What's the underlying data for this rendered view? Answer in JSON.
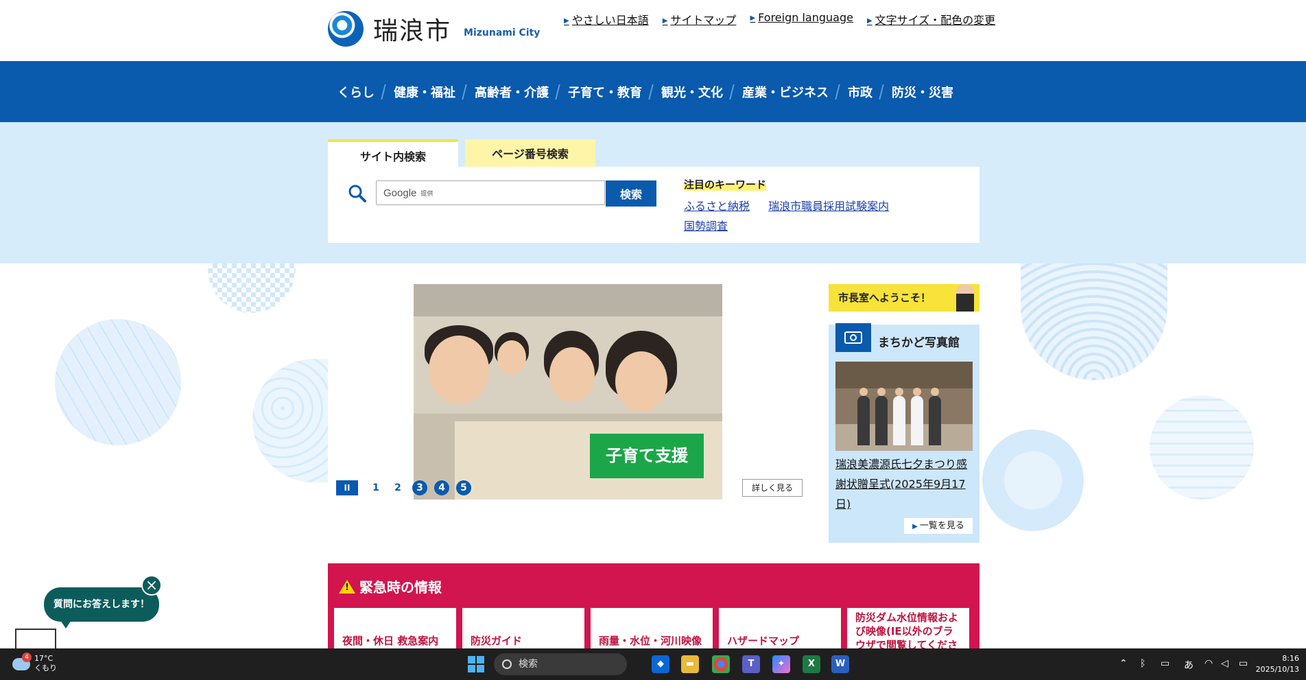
{
  "header": {
    "logo_text": "瑞浪市",
    "logo_sub": "Mizunami City",
    "util_links": [
      "やさしい日本語",
      "サイトマップ",
      "Foreign language",
      "文字サイズ・配色の変更"
    ]
  },
  "nav": [
    "くらし",
    "健康・福祉",
    "高齢者・介護",
    "子育て・教育",
    "観光・文化",
    "産業・ビジネス",
    "市政",
    "防災・災害"
  ],
  "search": {
    "tab_site": "サイト内検索",
    "tab_page": "ページ番号検索",
    "input_brand": "Google",
    "input_brand_sub": "提供",
    "button": "検索",
    "keywords_title": "注目のキーワード",
    "keywords": [
      "ふるさと納税",
      "瑞浪市職員採用試験案内",
      "国勢調査"
    ]
  },
  "slider": {
    "badge": "子育て支援",
    "pause": "II",
    "dots": [
      "1",
      "2",
      "3",
      "4",
      "5"
    ],
    "more": "詳しく見る"
  },
  "sidebar": {
    "mayor": "市長室へようこそ！",
    "photo_title": "まちかど写真館",
    "photo_caption": "瑞浪美濃源氏七夕まつり感謝状贈呈式(2025年9月17日)",
    "list_button": "一覧を見る"
  },
  "emergency": {
    "title": "緊急時の情報",
    "cards": [
      "夜間・休日 救急案内",
      "防災ガイド",
      "雨量・水位・河川映像",
      "ハザードマップ",
      "防災ダム水位情報および映像(IE以外のブラウザで閲覧してください)"
    ]
  },
  "chat": {
    "label": "質問にお答えします！"
  },
  "taskbar": {
    "temp": "17°C",
    "weather": "くもり",
    "search": "検索",
    "ime": "あ",
    "time": "8:16",
    "date": "2025/10/13"
  },
  "colors": {
    "brand_blue": "#0a5aad",
    "emergency_red": "#d2144f",
    "highlight_yellow": "#f7e33a"
  }
}
